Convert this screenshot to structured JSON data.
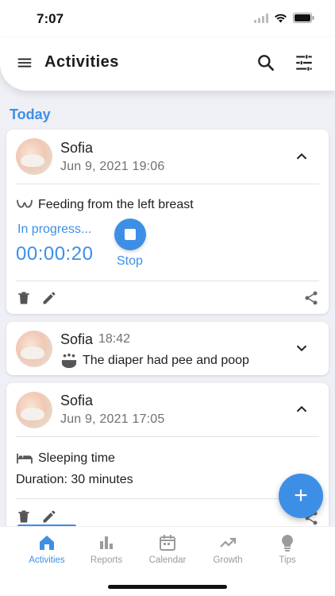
{
  "status_bar": {
    "time": "7:07"
  },
  "app_bar": {
    "title": "Activities"
  },
  "section": {
    "today_label": "Today"
  },
  "cards": [
    {
      "name": "Sofia",
      "datetime": "Jun 9, 2021 19:06",
      "activity": "Feeding from the left breast",
      "progress_label": "In progress...",
      "timer": "00:00:20",
      "stop_label": "Stop",
      "expanded": true
    },
    {
      "name": "Sofia",
      "time": "18:42",
      "activity": "The diaper had pee and poop",
      "expanded": false
    },
    {
      "name": "Sofia",
      "datetime": "Jun 9, 2021 17:05",
      "activity": "Sleeping time",
      "duration": "Duration: 30 minutes",
      "expanded": true
    }
  ],
  "fab": {
    "label": "+"
  },
  "bottom_nav": {
    "items": [
      {
        "label": "Activities",
        "icon": "home-icon",
        "active": true
      },
      {
        "label": "Reports",
        "icon": "bar-chart-icon",
        "active": false
      },
      {
        "label": "Calendar",
        "icon": "calendar-icon",
        "active": false
      },
      {
        "label": "Growth",
        "icon": "trending-up-icon",
        "active": false
      },
      {
        "label": "Tips",
        "icon": "lightbulb-icon",
        "active": false
      }
    ]
  },
  "colors": {
    "accent": "#3d8fe6",
    "background": "#eef0f5",
    "text": "#222222",
    "muted": "#707070"
  }
}
